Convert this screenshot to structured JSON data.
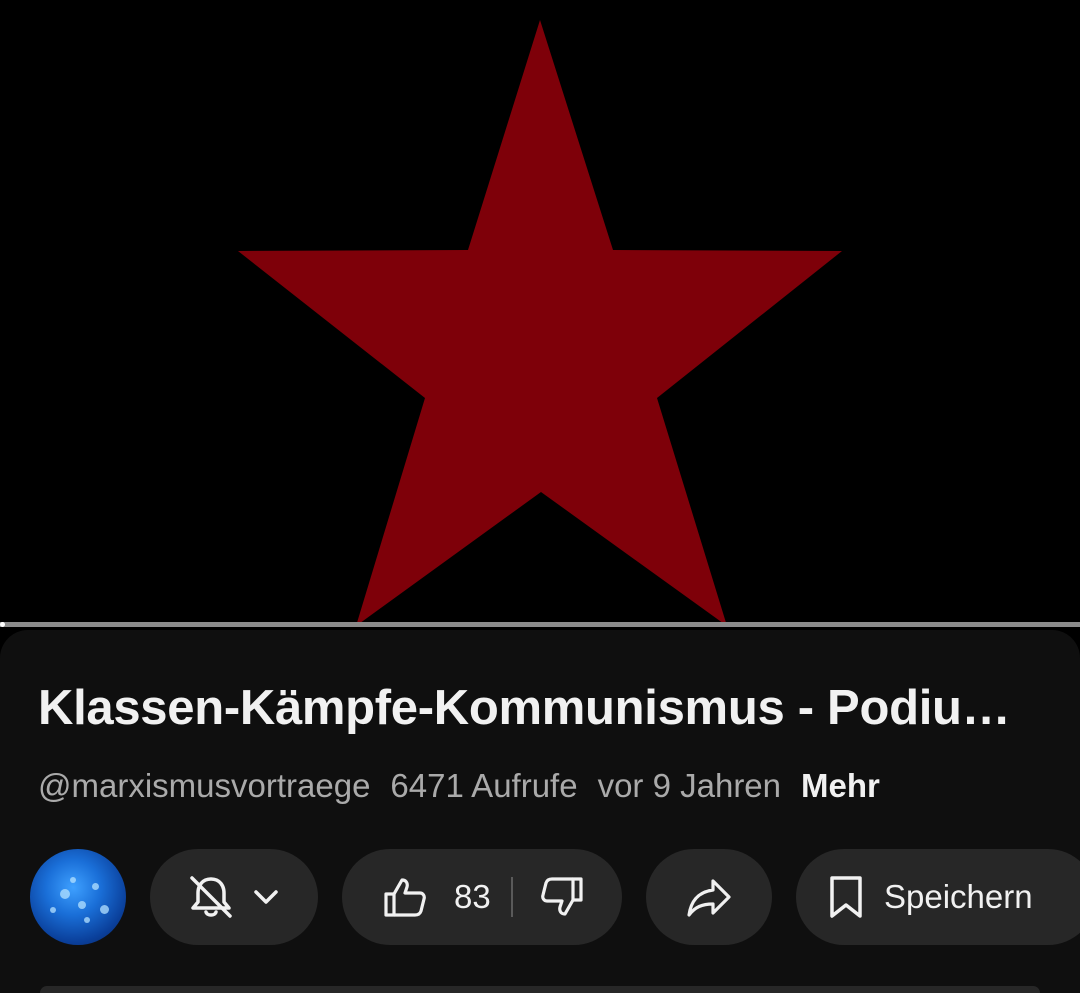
{
  "video": {
    "title": "Klassen-Kämpfe-Kommunismus - Podiu…",
    "channel_handle": "@marxismusvortraege",
    "views": "6471 Aufrufe",
    "age": "vor 9 Jahren",
    "more_label": "Mehr"
  },
  "actions": {
    "like_count": "83",
    "save_label": "Speichern",
    "bell_icon": "bell-off-icon",
    "share_icon": "share-icon"
  },
  "colors": {
    "star": "#7e0009",
    "panel_bg": "#0f0f0f",
    "pill_bg": "#272727",
    "text_primary": "#f1f1f1",
    "text_secondary": "#aaaaaa"
  }
}
